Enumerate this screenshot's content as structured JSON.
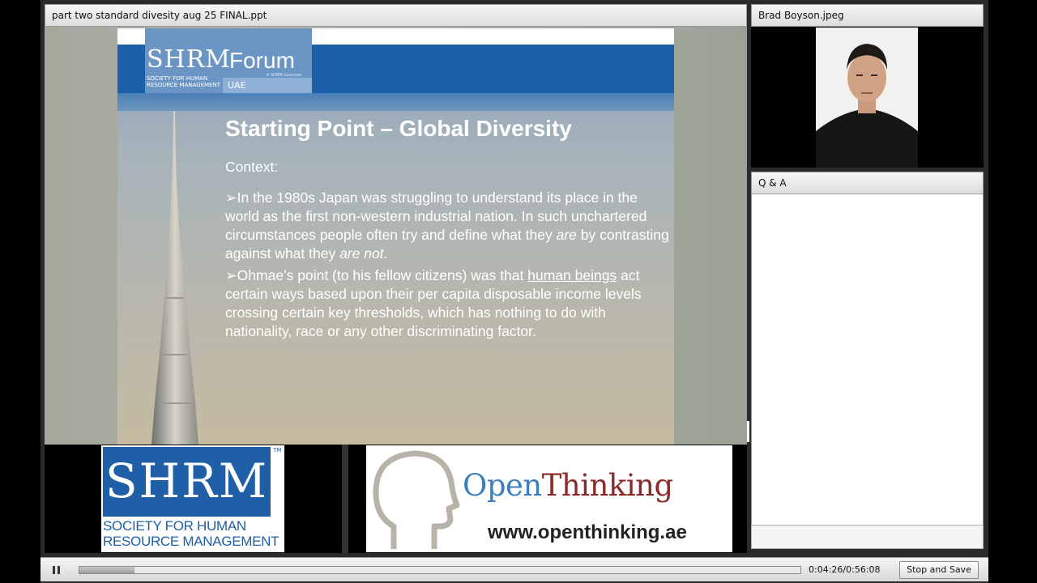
{
  "slide_pod": {
    "title": "part two standard divesity aug 25 FINAL.ppt",
    "slide": {
      "logo_letters": "SHRM",
      "logo_subtext": "SOCIETY FOR HUMAN RESOURCE MANAGEMENT",
      "forum": "Forum",
      "forum_sub": "A SHRM Licensee",
      "region": "UAE",
      "heading": "Starting Point – Global Diversity",
      "context_label": "Context:",
      "bullet_char": "➢",
      "bullet1_a": "In the 1980s Japan was struggling to understand its place in the world as the first non-western industrial nation. In such unchartered circumstances people often try and define what they ",
      "bullet1_em1": "are",
      "bullet1_b": " by contrasting against what they ",
      "bullet1_em2": "are not",
      "bullet1_c": ".",
      "bullet2_a": "Ohmae’s point (to his fellow citizens) was that ",
      "bullet2_u": "human beings",
      "bullet2_b": " act certain ways based upon their per capita disposable income levels crossing certain key thresholds, which has nothing to do with nationality, race or any other discriminating factor."
    }
  },
  "camera_pod": {
    "title": "Brad Boyson.jpeg"
  },
  "qa_pod": {
    "title": "Q & A"
  },
  "sponsors": {
    "shrm": {
      "letters": "SHRM",
      "tm": "TM",
      "line1": "SOCIETY FOR HUMAN",
      "line2": "RESOURCE MANAGEMENT"
    },
    "openthinking": {
      "open": "Open",
      "thinking": "Thinking",
      "url": "www.openthinking.ae"
    }
  },
  "playback": {
    "pause_icon": "pause-icon",
    "progress": 0.0765,
    "time": "0:04:26/0:56:08",
    "stop_label": "Stop and Save"
  }
}
